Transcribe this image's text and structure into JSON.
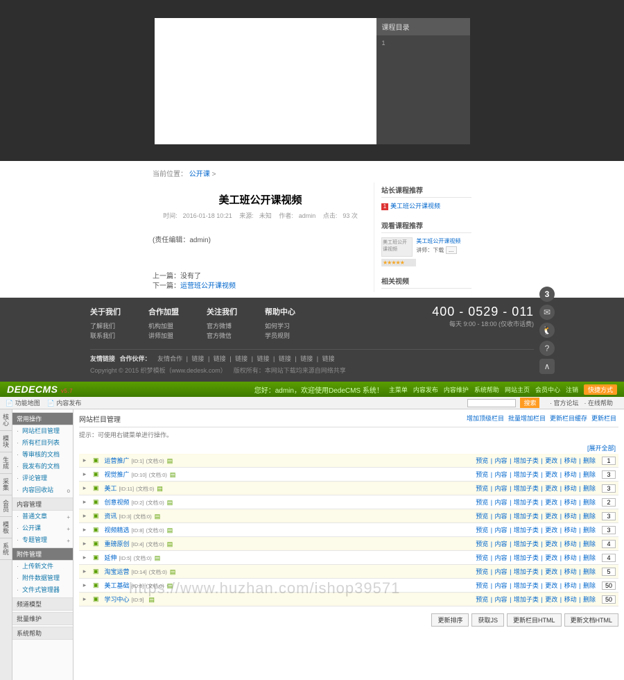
{
  "videoPanel": {
    "hd": "课程目录",
    "bd": "1"
  },
  "breadcrumb": {
    "p1": "当前位置：",
    "p2": "公开课",
    "sep": " > "
  },
  "course": {
    "title": "美工班公开课视频",
    "meta": {
      "time_lbl": "时间:",
      "time": "2016-01-18 10:21",
      "src_lbl": "来源:",
      "src": "未知",
      "author_lbl": "作者:",
      "author": "admin",
      "clicks_lbl": "点击:",
      "clicks": "93 次"
    },
    "body": "(责任编辑：admin)",
    "prev_lbl": "上一篇：",
    "prev": "没有了",
    "next_lbl": "下一篇：",
    "next": "运营班公开课视频"
  },
  "side": {
    "rec_hd": "站长课程推荐",
    "rec_item": "美工班公开课视频",
    "watch_hd": "观看课程推荐",
    "card": {
      "thumb": "美工班公开课视频",
      "title": "美工班公开课视频",
      "sub": "讲师：下载",
      "stars": "★★★★★"
    },
    "related_hd": "相关视频"
  },
  "footer": {
    "cols": [
      {
        "h": "关于我们",
        "links": [
          "了解我们",
          "联系我们"
        ]
      },
      {
        "h": "合作加盟",
        "links": [
          "机构加盟",
          "讲师加盟"
        ]
      },
      {
        "h": "关注我们",
        "links": [
          "官方微博",
          "官方微信"
        ]
      },
      {
        "h": "帮助中心",
        "links": [
          "如何学习",
          "学员规则"
        ]
      }
    ],
    "hotline": "400 - 0529 - 011",
    "hours": "每天 9:00 - 18:00 (仅收市话费)",
    "float_badge": "3",
    "friend_lbl": "友情链接",
    "friend_lbl2": "合作伙伴：",
    "friend_sep": " | ",
    "friends": [
      "友情合作",
      "链接",
      "链接",
      "链接",
      "链接",
      "链接",
      "链接",
      "链接"
    ],
    "copy1": "Copyright © 2015 织梦模板（www.dedesk.com）",
    "copy2": "版权所有：本网站下载均来源自网络共享"
  },
  "admin": {
    "logo": "DEDECMS",
    "ver": "v5.7",
    "user_lbl": "您好：",
    "user": "admin",
    "user_note": "，欢迎使用DedeCMS 系统！",
    "top_links": [
      "主菜单",
      "内容发布",
      "内容维护",
      "系统帮助",
      "网站主页",
      "会员中心",
      "注销"
    ],
    "top_btn": "快捷方式",
    "menu_left": [
      "功能地图",
      "内容发布"
    ],
    "search_btn": "搜索",
    "menu_right": [
      "官方论坛",
      "在线帮助"
    ],
    "vtabs": [
      "核心",
      "模块",
      "生成",
      "采集",
      "会员",
      "模板",
      "系统"
    ],
    "side": [
      {
        "h": "常用操作",
        "cls": "dark",
        "items": [
          {
            "t": "网站栏目管理",
            "b": ""
          },
          {
            "t": "所有栏目列表",
            "b": ""
          },
          {
            "t": "等审核的文档",
            "b": ""
          },
          {
            "t": "我发布的文档",
            "b": ""
          },
          {
            "t": "评论管理",
            "b": ""
          },
          {
            "t": "内容回收站",
            "b": "o"
          }
        ]
      },
      {
        "h": "内容管理",
        "cls": "",
        "items": [
          {
            "t": "普通文章",
            "b": "+"
          },
          {
            "t": "公开课",
            "b": "+"
          },
          {
            "t": "专题管理",
            "b": "+"
          }
        ]
      },
      {
        "h": "附件管理",
        "cls": "dark",
        "items": [
          {
            "t": "上传新文件",
            "b": ""
          },
          {
            "t": "附件数据管理",
            "b": ""
          },
          {
            "t": "文件式管理器",
            "b": ""
          }
        ]
      },
      {
        "h": "频道模型",
        "cls": "",
        "items": []
      },
      {
        "h": "批量维护",
        "cls": "",
        "items": []
      },
      {
        "h": "系统帮助",
        "cls": "",
        "items": []
      }
    ],
    "crumb": "网站栏目管理",
    "crumb_ops": [
      "增加顶级栏目",
      "批量增加栏目",
      "更新栏目缓存",
      "更新栏目"
    ],
    "tip": "提示：可使用右键菜单进行操作。",
    "expand": "[展开全部]",
    "ops": [
      "预览",
      "内容",
      "增加子类",
      "更改",
      "移动",
      "删除"
    ],
    "rows": [
      {
        "t": "运营推广",
        "id": "[ID:1]",
        "doc": "(文档:0)",
        "sort": "1"
      },
      {
        "t": "视觉推广",
        "id": "[ID:10]",
        "doc": "(文档:0)",
        "sort": "3"
      },
      {
        "t": "美工",
        "id": "[ID:11]",
        "doc": "(文档:0)",
        "sort": "3"
      },
      {
        "t": "创意视频",
        "id": "[ID:2]",
        "doc": "(文档:0)",
        "sort": "2"
      },
      {
        "t": "资讯",
        "id": "[ID:3]",
        "doc": "(文档:0)",
        "sort": "3"
      },
      {
        "t": "视频精选",
        "id": "[ID:8]",
        "doc": "(文档:0)",
        "sort": "3"
      },
      {
        "t": "重磅原创",
        "id": "[ID:4]",
        "doc": "(文档:0)",
        "sort": "4"
      },
      {
        "t": "延伸",
        "id": "[ID:5]",
        "doc": "(文档:0)",
        "sort": "4"
      },
      {
        "t": "淘宝运营",
        "id": "[ID:14]",
        "doc": "(文档:0)",
        "sort": "5"
      },
      {
        "t": "美工基础",
        "id": "[ID:6]",
        "doc": "(文档:0)",
        "sort": "50"
      },
      {
        "t": "学习中心",
        "id": "[ID:9]",
        "doc": "",
        "sort": "50"
      }
    ],
    "btns": [
      "更新排序",
      "获取JS",
      "更新栏目HTML",
      "更新文档HTML"
    ],
    "watermark": "https://www.huzhan.com/ishop39571"
  }
}
